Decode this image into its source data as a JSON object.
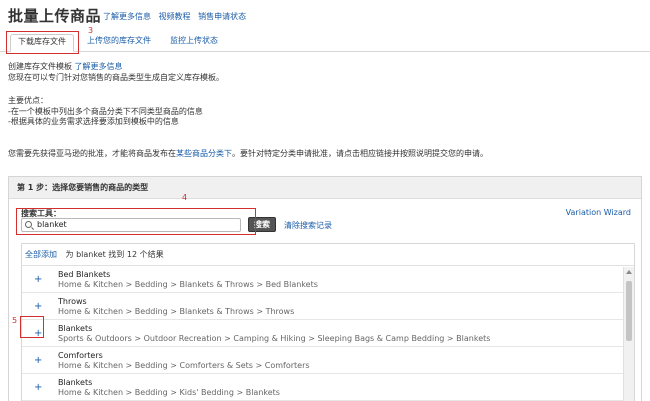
{
  "header": {
    "title": "批量上传商品",
    "links": [
      "了解更多信息",
      "视频教程",
      "销售申请状态"
    ]
  },
  "tabs": [
    {
      "label": "下载库存文件",
      "active": true
    },
    {
      "label": "上传您的库存文件",
      "active": false
    },
    {
      "label": "监控上传状态",
      "active": false
    }
  ],
  "annotations": {
    "tab_marker": "3",
    "search_marker": "4",
    "row_marker": "5"
  },
  "intro": {
    "line1": "创建库存文件模板",
    "line1_link": "了解更多信息",
    "line2": "您现在可以专门针对您销售的商品类型生成自定义库存模板。",
    "advantages_title": "主要优点：",
    "advantage_1": "-在一个模板中列出多个商品分类下不同类型商品的信息",
    "advantage_2": "-根据具体的业务需求选择要添加到模板中的信息",
    "approval_text_1": "您需要先获得亚马逊的批准，才能将商品发布在",
    "approval_link": "某些商品分类下",
    "approval_text_2": "。要针对特定分类申请批准，请点击相应链接并按照说明提交您的申请。"
  },
  "step": {
    "header": "第 1 步：选择您要销售的商品的类型",
    "search_label": "搜索工具：",
    "search_value": "blanket",
    "search_button": "搜索",
    "clear_link": "清除搜索记录",
    "variation_wizard": "Variation Wizard"
  },
  "results": {
    "add_all": "全部添加",
    "summary": "为 blanket 找到 12 个结果",
    "items": [
      {
        "title": "Bed Blankets",
        "path": "Home & Kitchen > Bedding > Blankets & Throws > Bed Blankets"
      },
      {
        "title": "Throws",
        "path": "Home & Kitchen > Bedding > Blankets & Throws > Throws"
      },
      {
        "title": "Blankets",
        "path": "Sports & Outdoors > Outdoor Recreation > Camping & Hiking > Sleeping Bags & Camp Bedding > Blankets"
      },
      {
        "title": "Comforters",
        "path": "Home & Kitchen > Bedding > Comforters & Sets > Comforters"
      },
      {
        "title": "Blankets",
        "path": "Home & Kitchen > Bedding > Kids' Bedding > Blankets"
      }
    ],
    "add_symbol": "+"
  },
  "colors": {
    "link": "#1a5ca8",
    "annotation": "#d32f2f",
    "button": "#555555"
  }
}
